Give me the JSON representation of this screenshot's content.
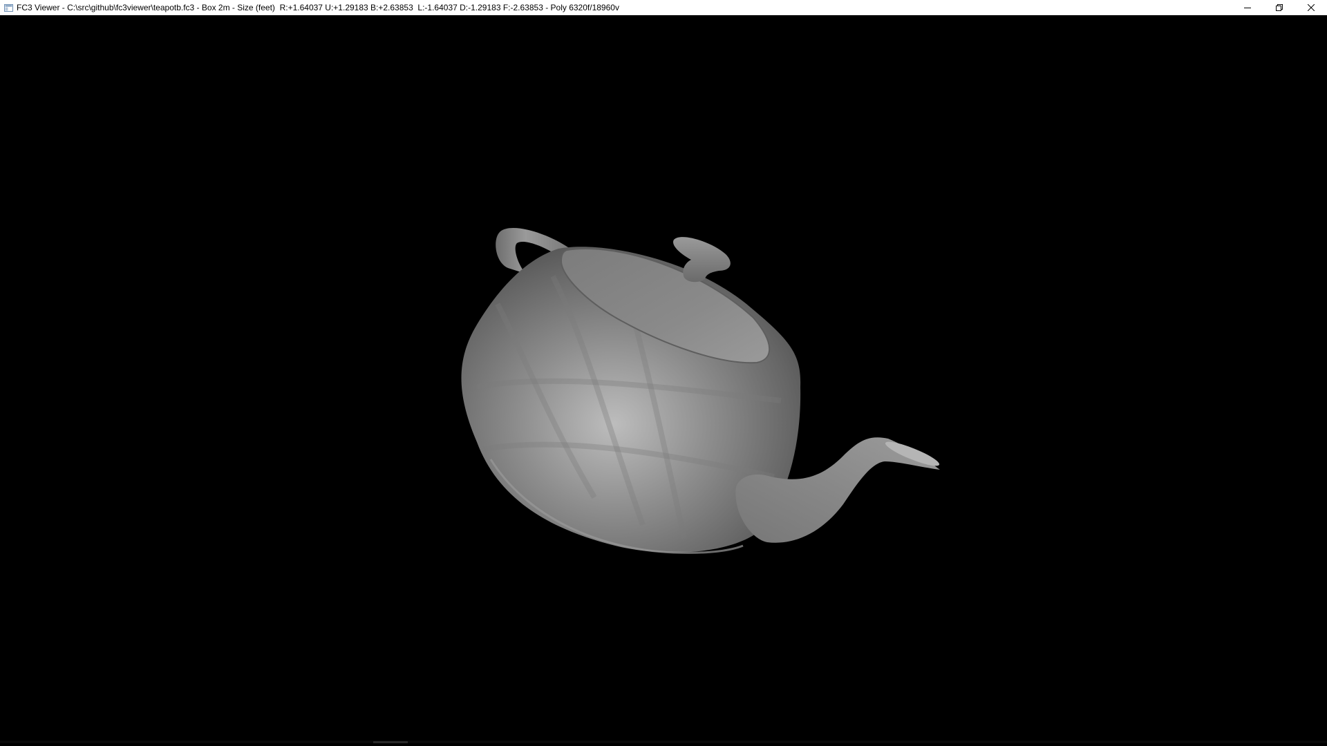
{
  "window": {
    "title": "FC3 Viewer - C:\\src\\github\\fc3viewer\\teapotb.fc3 - Box 2m - Size (feet)  R:+1.64037 U:+1.29183 B:+2.63853  L:-1.64037 D:-1.29183 F:-2.63853 - Poly 6320f/18960v",
    "app_icon": "window-app-icon",
    "controls": [
      "minimize-icon",
      "restore-icon",
      "close-icon"
    ]
  },
  "viewport": {
    "background": "#000000",
    "model": "teapot",
    "shading_color": "#8c8c8c"
  }
}
